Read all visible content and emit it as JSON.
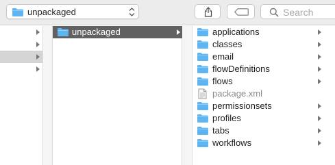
{
  "toolbar": {
    "path_label": "unpackaged",
    "search_placeholder": "Search"
  },
  "icons": {
    "folder": "folder-icon",
    "file": "file-icon",
    "share": "share-icon",
    "tag": "tag-icon",
    "search": "search-icon",
    "chevron": "chevron-right-icon",
    "updown": "updown-arrows-icon"
  },
  "colors": {
    "folder_blue": "#5fb4f2",
    "selected_active": "#616161",
    "selected_inactive": "#d5d5d5"
  },
  "column1": {
    "rows": 4,
    "selected_index": 2
  },
  "column2": {
    "items": [
      {
        "label": "unpackaged",
        "selected": true,
        "has_children": true
      }
    ]
  },
  "column3": {
    "items": [
      {
        "label": "applications",
        "kind": "folder"
      },
      {
        "label": "classes",
        "kind": "folder"
      },
      {
        "label": "email",
        "kind": "folder"
      },
      {
        "label": "flowDefinitions",
        "kind": "folder"
      },
      {
        "label": "flows",
        "kind": "folder"
      },
      {
        "label": "package.xml",
        "kind": "file"
      },
      {
        "label": "permissionsets",
        "kind": "folder"
      },
      {
        "label": "profiles",
        "kind": "folder"
      },
      {
        "label": "tabs",
        "kind": "folder"
      },
      {
        "label": "workflows",
        "kind": "folder"
      }
    ]
  }
}
